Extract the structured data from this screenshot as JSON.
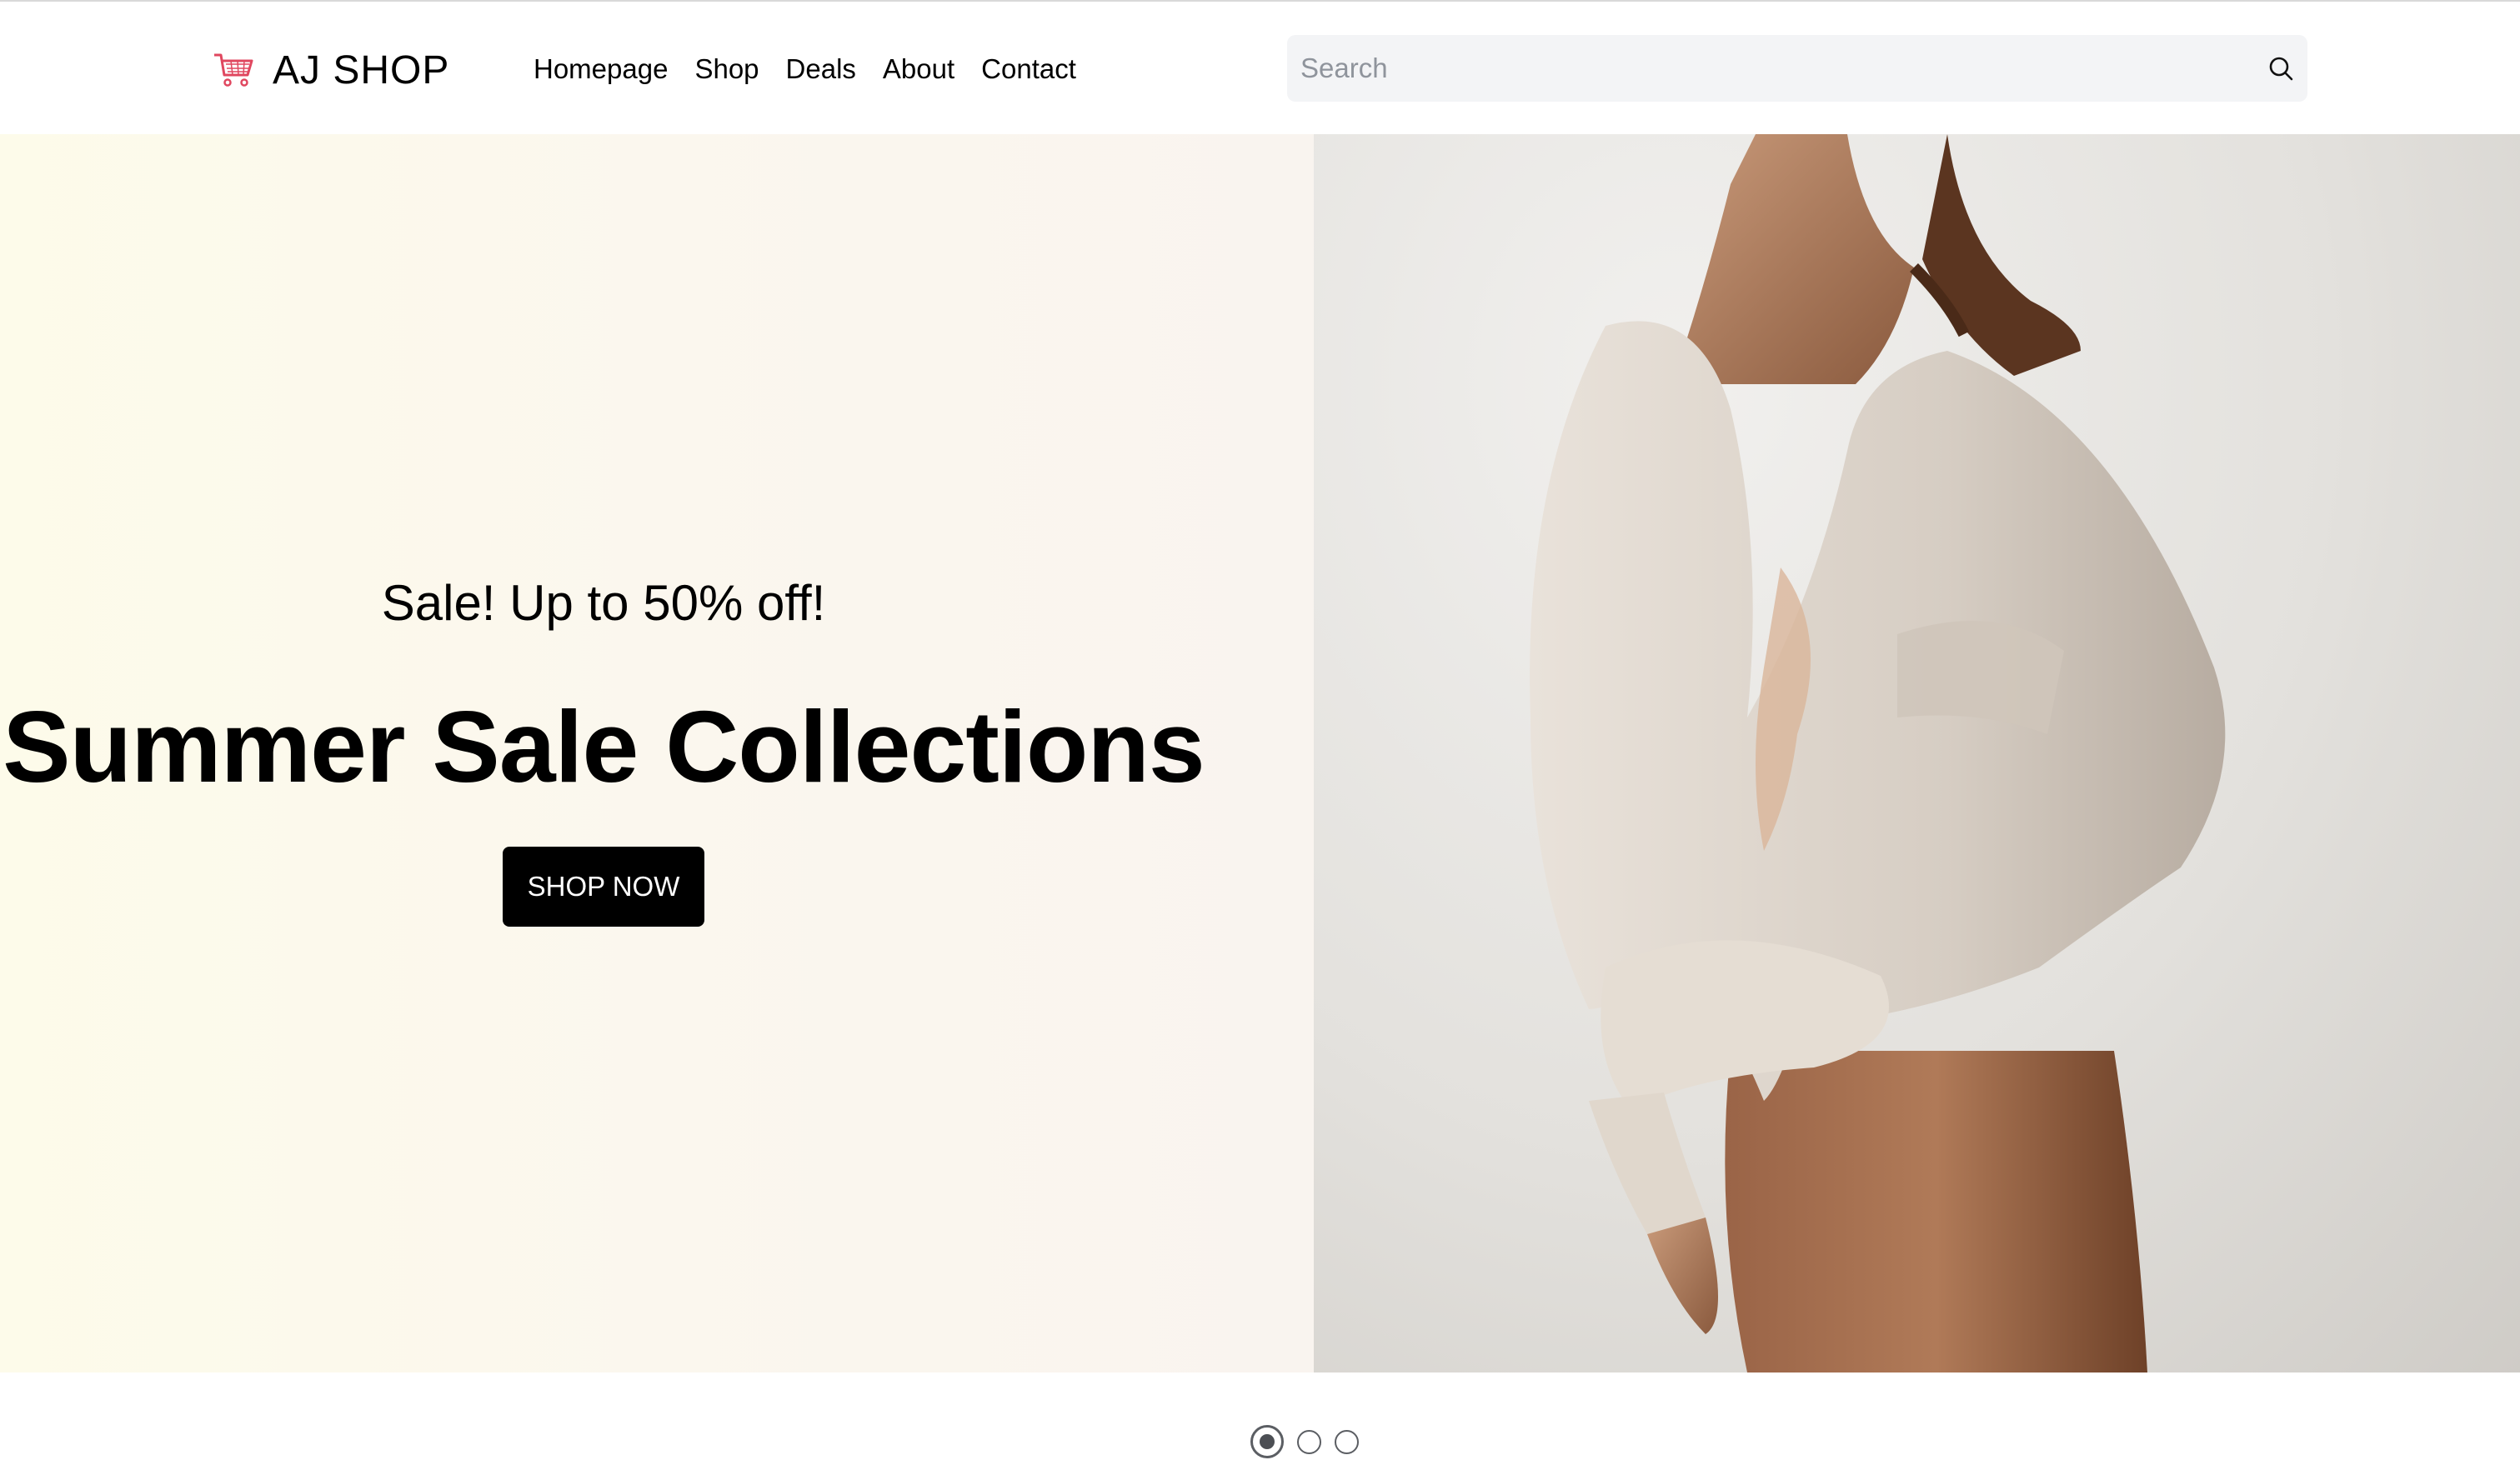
{
  "header": {
    "logo_text": "AJ SHOP",
    "logo_icon": "shopping-cart-icon",
    "nav": [
      {
        "label": "Homepage"
      },
      {
        "label": "Shop"
      },
      {
        "label": "Deals"
      },
      {
        "label": "About"
      },
      {
        "label": "Contact"
      }
    ],
    "search": {
      "placeholder": "Search",
      "value": "",
      "icon": "search-icon"
    }
  },
  "hero": {
    "subtitle": "Sale! Up to 50% off!",
    "title": "Summer Sale Collections",
    "cta_label": "SHOP NOW",
    "slides_total": 3,
    "active_slide": 1
  },
  "colors": {
    "cta_background": "#000000",
    "cart_icon": "#e0475f",
    "search_background": "#f3f4f6",
    "hero_left_background": "#fbf7ee"
  }
}
